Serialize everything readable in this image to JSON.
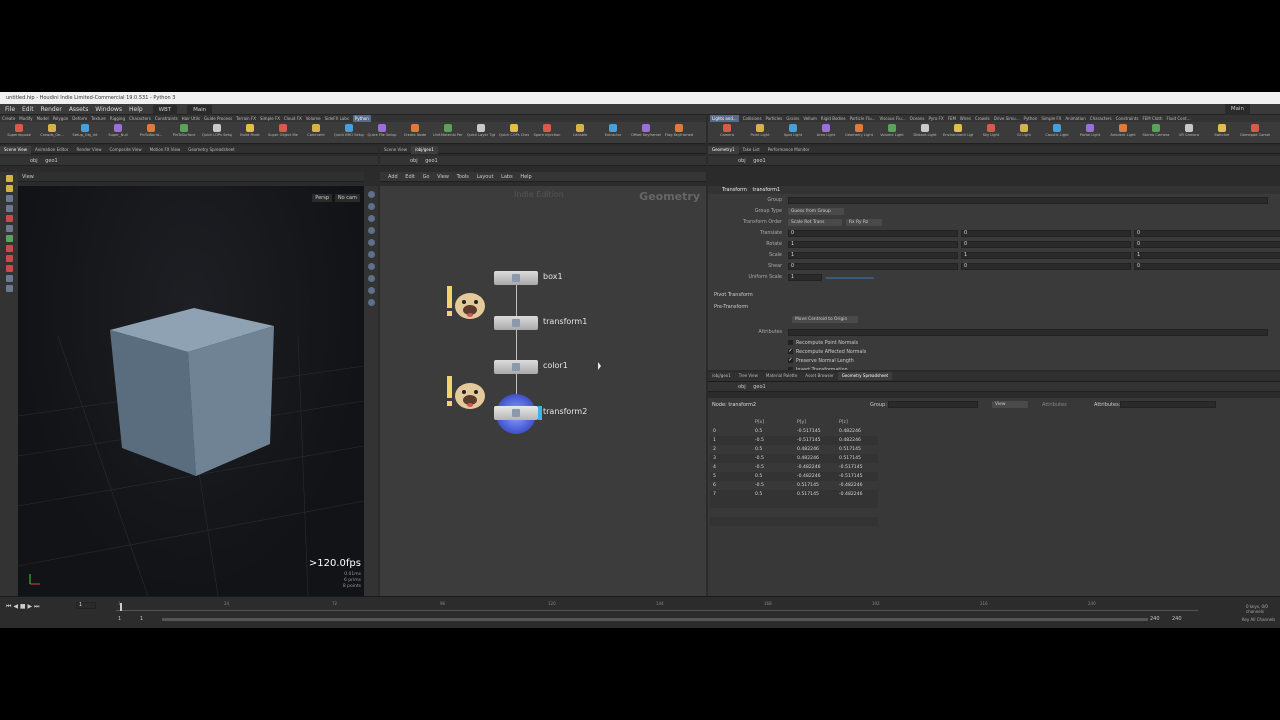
{
  "title": "untitled.hip - Houdini Indie Limited-Commercial 19.0.531 - Python 3",
  "menu": [
    "File",
    "Edit",
    "Render",
    "Assets",
    "Windows",
    "Help"
  ],
  "desktop_left": "WBT",
  "desktop_right": "Main",
  "desktop_far_right": "Main",
  "shelf_tabs_left": [
    "Create",
    "Modify",
    "Model",
    "Polygon",
    "Deform",
    "Texture",
    "Rigging",
    "Characters",
    "Constraints",
    "Hair Utils",
    "Guide Process",
    "Terrain FX",
    "Simple FX",
    "Cloud FX",
    "Volume",
    "SideFX Labs",
    "Python"
  ],
  "shelf_tabs_right": [
    "Lights and...",
    "Collisions",
    "Particles",
    "Grains",
    "Vellum",
    "Rigid Bodies",
    "Particle Flu...",
    "Viscous Flu...",
    "Oceans",
    "Pyro FX",
    "FEM",
    "Wires",
    "Crowds",
    "Drive Simu...",
    "Python",
    "Simple FX",
    "Animation",
    "Characters",
    "Constraints",
    "FEM Cloth",
    "Fluid Cont..."
  ],
  "shelf_tools_left": [
    "Superimpose",
    "Crowds_Ge...",
    "Setup_Obj_Int",
    "Super_Null",
    "PinToWorld...",
    "PinToSurface",
    "Quick LOPs Setup",
    "Build Rivet",
    "Super Object Merge",
    "Comment",
    "Quick BRO Setup",
    "Quick File Setup",
    "Create Node",
    "Unif.Material Per Node",
    "Quick Layer Tgt",
    "Quick COPs Check",
    "Spare Injection",
    "Callable",
    "Extractor",
    "Offset Keyframes",
    "Flag Keyframed"
  ],
  "shelf_tools_right": [
    "Camera",
    "Point Light",
    "Spot Light",
    "Area Light",
    "Geometry Light",
    "Volume Light",
    "Distant Light",
    "Environment Light",
    "Sky Light",
    "GI Light",
    "Caustic Light",
    "Portal Light",
    "Ambient Light",
    "Stereo Camera",
    "VR Camera",
    "Switcher",
    "Gamepad Camera"
  ],
  "left_tabs": [
    "Scene View",
    "Animation Editor",
    "Render View",
    "Composite View",
    "Motion FX View",
    "Geometry Spreadsheet"
  ],
  "mid_tabs": [
    "Scene View",
    "/obj/geo1"
  ],
  "param_tabs": [
    "Geometry1",
    "Take List",
    "Performance Monitor"
  ],
  "path": {
    "obj": "obj",
    "geo": "geo1"
  },
  "viewport": {
    "label": "View",
    "persp": "Persp",
    "cam": "No cam",
    "fps": ">120.0fps",
    "ms": "0.01ms",
    "prims": "6 prims",
    "points": "8 points"
  },
  "network": {
    "menu": [
      "Add",
      "Edit",
      "Go",
      "View",
      "Tools",
      "Layout",
      "Labs",
      "Help"
    ],
    "watermark": "Indie Edition",
    "context": "Geometry",
    "nodes": [
      {
        "name": "box1"
      },
      {
        "name": "transform1"
      },
      {
        "name": "color1"
      },
      {
        "name": "transform2"
      }
    ]
  },
  "params": {
    "header_type": "Transform",
    "header_name": "transform1",
    "rows": [
      {
        "label": "Group",
        "value": ""
      },
      {
        "label": "Group Type",
        "value": "Guess from Group"
      },
      {
        "label": "Transform Order",
        "value": "Scale Rot Trans",
        "value2": "Rx Ry Rz"
      },
      {
        "label": "Translate",
        "x": "0",
        "y": "0",
        "z": "0"
      },
      {
        "label": "Rotate",
        "x": "1",
        "y": "0",
        "z": "0"
      },
      {
        "label": "Scale",
        "x": "1",
        "y": "1",
        "z": "1"
      },
      {
        "label": "Shear",
        "x": "0",
        "y": "0",
        "z": "0"
      },
      {
        "label": "Uniform Scale",
        "x": "1"
      }
    ],
    "folders": [
      "Pivot Transform",
      "Pre-Transform"
    ],
    "move_button": "Move Centroid to Origin",
    "attributes_label": "Attributes",
    "checks": [
      {
        "label": "Recompute Point Normals",
        "on": false
      },
      {
        "label": "Recompute Affected Normals",
        "on": true
      },
      {
        "label": "Preserve Normal Length",
        "on": true
      },
      {
        "label": "Invert Transformation",
        "on": false
      }
    ]
  },
  "sheet_tabs": [
    "/obj/geo1",
    "Tree View",
    "Material Palette",
    "Asset Browser",
    "Geometry Spreadsheet"
  ],
  "sheet": {
    "node_label": "Node: transform2",
    "group_label": "Group:",
    "view_label": "View",
    "attribs_label": "Attributes:",
    "attribs_btn": "Attributes",
    "columns": [
      "",
      "P[x]",
      "P[y]",
      "P[z]"
    ],
    "rows": [
      [
        "0",
        "0.5",
        "-0.517145",
        "0.482246"
      ],
      [
        "1",
        "-0.5",
        "-0.517145",
        "0.482246"
      ],
      [
        "2",
        "0.5",
        "0.482246",
        "0.517145"
      ],
      [
        "3",
        "-0.5",
        "0.482246",
        "0.517145"
      ],
      [
        "4",
        "-0.5",
        "-0.482246",
        "-0.517145"
      ],
      [
        "5",
        "0.5",
        "-0.482246",
        "-0.517145"
      ],
      [
        "6",
        "-0.5",
        "0.517145",
        "-0.482246"
      ],
      [
        "7",
        "0.5",
        "0.517145",
        "-0.482246"
      ]
    ]
  },
  "timeline": {
    "ticks": [
      "1",
      "24",
      "72",
      "96",
      "120",
      "144",
      "168",
      "192",
      "216",
      "240"
    ],
    "frame_current": "1",
    "start": "1",
    "start2": "1",
    "end": "240",
    "end2": "240",
    "keys": "0 keys, 0/0 channels",
    "key_all": "Key All Channels"
  },
  "colors": {
    "panel": "#2b2b2b",
    "cube_top": "#8fa4b6",
    "cube_left": "#5b6f80",
    "cube_right": "#6f8496",
    "selected_node": "#38b6e8"
  }
}
